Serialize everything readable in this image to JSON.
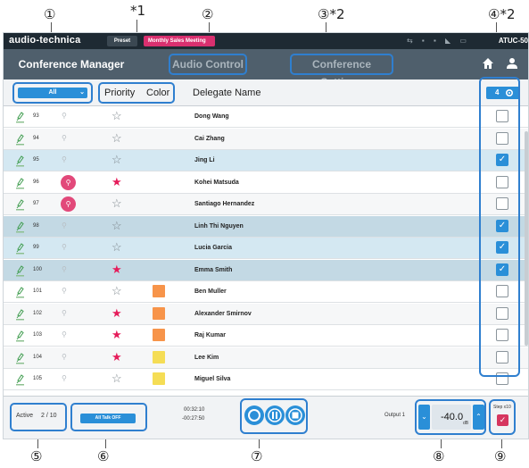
{
  "callouts": {
    "c1": "①",
    "c1_note": "*1",
    "c2": "②",
    "c3": "③*2",
    "c4": "④*2",
    "c5": "⑤",
    "c6": "⑥",
    "c7": "⑦",
    "c8": "⑧",
    "c9": "⑨"
  },
  "topbar": {
    "brand": "audio-technica",
    "preset": "Preset",
    "meeting": "Monthly Sales Meeting",
    "model": "ATUC-50"
  },
  "nav": {
    "conference_manager": "Conference Manager",
    "audio_control": "Audio Control",
    "conference_settings": "Conference Settings"
  },
  "header": {
    "filter": "All",
    "priority": "Priority",
    "color": "Color",
    "delegate_name": "Delegate Name",
    "selected_count": "4"
  },
  "colors": {
    "accent": "#2a8fd8",
    "priority_on": "#e51c5a",
    "orange": "#f7944a",
    "yellow": "#f5dd55",
    "talk_active": "#e2497a"
  },
  "rows": [
    {
      "seat": "93",
      "talking": false,
      "priority": false,
      "color": "",
      "name": "Dong Wang",
      "checked": false,
      "bg": "odd"
    },
    {
      "seat": "94",
      "talking": false,
      "priority": false,
      "color": "",
      "name": "Cai Zhang",
      "checked": false,
      "bg": "even"
    },
    {
      "seat": "95",
      "talking": false,
      "priority": false,
      "color": "",
      "name": "Jing Li",
      "checked": true,
      "bg": "sel"
    },
    {
      "seat": "96",
      "talking": true,
      "priority": true,
      "color": "",
      "name": "Kohei Matsuda",
      "checked": false,
      "bg": "odd"
    },
    {
      "seat": "97",
      "talking": true,
      "priority": false,
      "color": "",
      "name": "Santiago Hernandez",
      "checked": false,
      "bg": "even"
    },
    {
      "seat": "98",
      "talking": false,
      "priority": false,
      "color": "",
      "name": "Linh Thi Nguyen",
      "checked": true,
      "bg": "hl"
    },
    {
      "seat": "99",
      "talking": false,
      "priority": false,
      "color": "",
      "name": "Lucia Garcia",
      "checked": true,
      "bg": "sel"
    },
    {
      "seat": "100",
      "talking": false,
      "priority": true,
      "color": "",
      "name": "Emma Smith",
      "checked": true,
      "bg": "hl"
    },
    {
      "seat": "101",
      "talking": false,
      "priority": false,
      "color": "#f7944a",
      "name": "Ben Muller",
      "checked": false,
      "bg": "odd"
    },
    {
      "seat": "102",
      "talking": false,
      "priority": true,
      "color": "#f7944a",
      "name": "Alexander Smirnov",
      "checked": false,
      "bg": "even"
    },
    {
      "seat": "103",
      "talking": false,
      "priority": true,
      "color": "#f7944a",
      "name": "Raj Kumar",
      "checked": false,
      "bg": "odd"
    },
    {
      "seat": "104",
      "talking": false,
      "priority": true,
      "color": "#f5dd55",
      "name": "Lee Kim",
      "checked": false,
      "bg": "even"
    },
    {
      "seat": "105",
      "talking": false,
      "priority": false,
      "color": "#f5dd55",
      "name": "Miguel Silva",
      "checked": false,
      "bg": "odd"
    }
  ],
  "bottom": {
    "active_label": "Active",
    "active_count": "2 / 10",
    "all_talk": "All Talk OFF",
    "elapsed": "00:32:10",
    "remaining": "-00:27:50",
    "output_label": "Output 1",
    "volume": "-40.0",
    "unit": "dB",
    "step": "Step x10"
  }
}
